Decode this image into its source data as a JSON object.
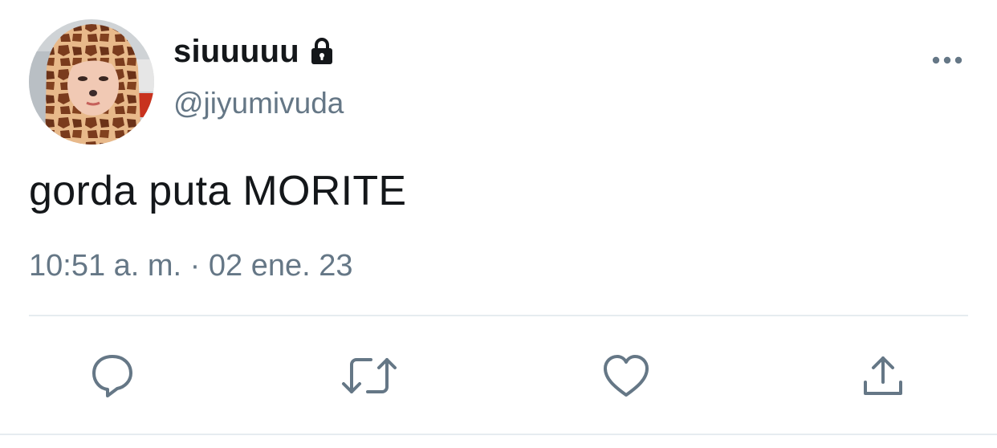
{
  "tweet": {
    "display_name": "siuuuuu",
    "handle": "@jiyumivuda",
    "text": "gorda puta MORITE",
    "timestamp": "10:51 a. m. · 02 ene. 23",
    "protected_icon": "lock-icon",
    "more_icon": "more-horizontal-icon"
  },
  "actions": [
    {
      "name": "reply",
      "icon": "reply-icon"
    },
    {
      "name": "retweet",
      "icon": "retweet-icon"
    },
    {
      "name": "like",
      "icon": "heart-icon"
    },
    {
      "name": "share",
      "icon": "share-icon"
    }
  ],
  "colors": {
    "text": "#14171a",
    "secondary": "#657786",
    "divider": "#e6ecf0",
    "background": "#ffffff"
  }
}
